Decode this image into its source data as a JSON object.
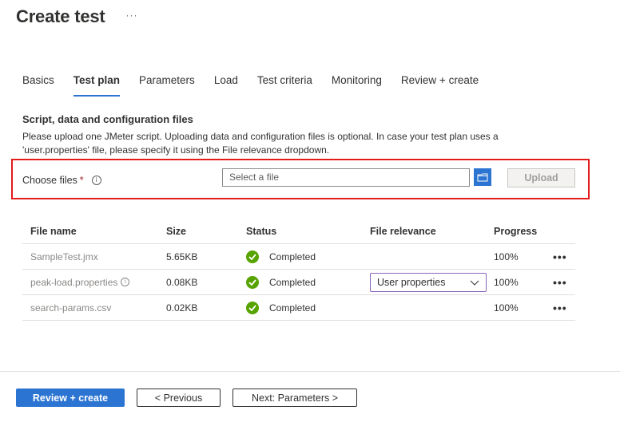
{
  "header": {
    "title": "Create test",
    "more_label": "···"
  },
  "tabs": [
    {
      "label": "Basics",
      "active": false
    },
    {
      "label": "Test plan",
      "active": true
    },
    {
      "label": "Parameters",
      "active": false
    },
    {
      "label": "Load",
      "active": false
    },
    {
      "label": "Test criteria",
      "active": false
    },
    {
      "label": "Monitoring",
      "active": false
    },
    {
      "label": "Review + create",
      "active": false
    }
  ],
  "section": {
    "heading": "Script, data and configuration files",
    "description": "Please upload one JMeter script. Uploading data and configuration files is optional. In case your test plan uses a 'user.properties' file, please specify it using the File relevance dropdown."
  },
  "chooser": {
    "label": "Choose files",
    "required_mark": "*",
    "info_icon": "i",
    "input_placeholder": "Select a file",
    "input_value": "",
    "upload_label": "Upload"
  },
  "table": {
    "headers": [
      "File name",
      "Size",
      "Status",
      "File relevance",
      "Progress"
    ],
    "rows": [
      {
        "name": "SampleTest.jmx",
        "has_info": false,
        "size": "5.65KB",
        "status": "Completed",
        "relevance": "",
        "progress": "100%",
        "more": "•••"
      },
      {
        "name": "peak-load.properties",
        "has_info": true,
        "size": "0.08KB",
        "status": "Completed",
        "relevance": "User properties",
        "progress": "100%",
        "more": "•••"
      },
      {
        "name": "search-params.csv",
        "has_info": false,
        "size": "0.02KB",
        "status": "Completed",
        "relevance": "",
        "progress": "100%",
        "more": "•••"
      }
    ]
  },
  "footer": {
    "review_create": "Review + create",
    "previous": "< Previous",
    "next": "Next: Parameters >"
  },
  "colors": {
    "accent": "#2b74d1",
    "success": "#57a300",
    "highlight": "#e21b1b",
    "dropdown_border": "#8764b8"
  }
}
